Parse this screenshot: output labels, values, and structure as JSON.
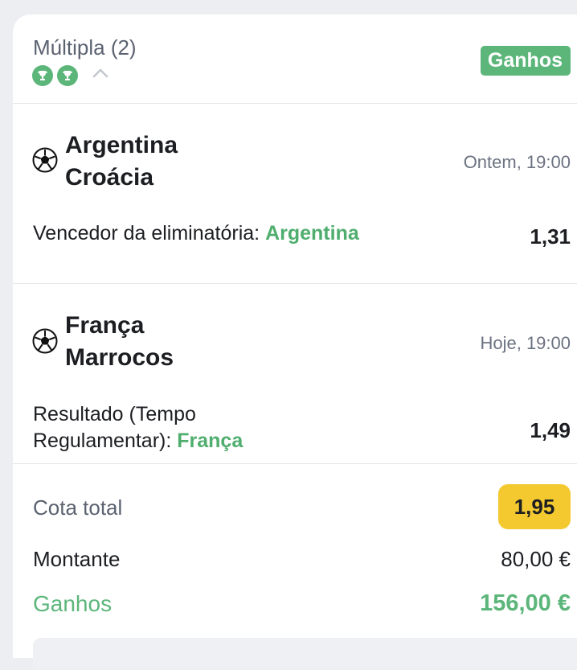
{
  "bet": {
    "title": "Múltipla (2)",
    "status_badge": "Ganhos",
    "trophy_count": 2
  },
  "events": [
    {
      "team_home": "Argentina",
      "team_away": "Croácia",
      "time": "Ontem, 19:00",
      "market_line1": "Vencedor da eliminatória: ",
      "market_line2": "",
      "selection": "Argentina",
      "odd": "1,31",
      "icon": "soccer-ball-icon"
    },
    {
      "team_home": "França",
      "team_away": "Marrocos",
      "time": "Hoje, 19:00",
      "market_line1": "Resultado (Tempo",
      "market_line2": "Regulamentar): ",
      "selection": "França",
      "odd": "1,49",
      "icon": "soccer-ball-icon"
    }
  ],
  "summary": {
    "total_odds_label": "Cota total",
    "total_odds": "1,95",
    "stake_label": "Montante",
    "stake": "80,00 €",
    "winnings_label": "Ganhos",
    "winnings": "156,00 €"
  },
  "colors": {
    "win_green": "#5cb67a",
    "selection_green": "#4fae6e",
    "odds_highlight": "#f4c930",
    "text_dark": "#1c1e22",
    "text_muted": "#6b7280"
  }
}
